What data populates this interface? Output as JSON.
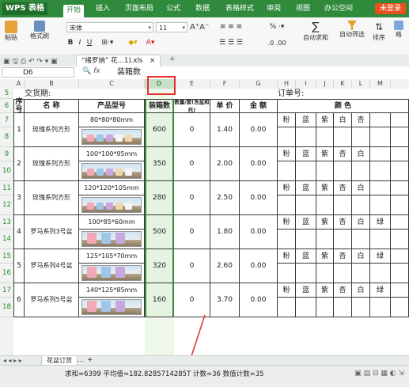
{
  "app": {
    "logo": "WPS 表格",
    "login": "未登录"
  },
  "menu": [
    "开始",
    "插入",
    "页面布局",
    "公式",
    "数据",
    "表格样式",
    "审阅",
    "视图",
    "办公空间"
  ],
  "ribbon": {
    "paste": "粘贴",
    "format_painter": "格式刷",
    "font_name": "宋体",
    "font_size": "11",
    "autosum": "自动求和",
    "autofilter": "自动筛选",
    "sort": "排序",
    "format_label": "格"
  },
  "document": {
    "tab": "“绪罗纳” 花…1).xls",
    "close": "×",
    "add": "+"
  },
  "formula_bar": {
    "cell_ref": "D6",
    "fx": "fx",
    "content": "装箱数"
  },
  "columns": [
    "A",
    "B",
    "C",
    "D",
    "E",
    "F",
    "G",
    "H",
    "I",
    "J",
    "K",
    "L",
    "M"
  ],
  "rows": [
    "5",
    "6",
    "7",
    "8",
    "9",
    "10",
    "11",
    "12",
    "13",
    "14",
    "15",
    "16",
    "17",
    "18"
  ],
  "sheet": {
    "delivery_label": "交货期:",
    "order_label": "订单号:",
    "headers": {
      "seq": "序号",
      "name": "名  称",
      "model": "产品型号",
      "box": "装箱数",
      "qty": "数量/套(含盆和托)",
      "price": "单 价",
      "amount": "金 额",
      "color": "颜    色"
    },
    "items": [
      {
        "seq": "1",
        "name": "玫瑰系列方形",
        "model": "80*80*80mm",
        "box": "600",
        "qty": "0",
        "price": "1.40",
        "amount": "0.00",
        "colors": [
          "粉",
          "蓝",
          "紫",
          "白",
          "杏"
        ]
      },
      {
        "seq": "2",
        "name": "玫瑰系列方形",
        "model": "100*100*95mm",
        "box": "350",
        "qty": "0",
        "price": "2.00",
        "amount": "0.00",
        "colors": [
          "粉",
          "蓝",
          "紫",
          "杏",
          "白"
        ]
      },
      {
        "seq": "3",
        "name": "玫瑰系列方形",
        "model": "120*120*105mm",
        "box": "280",
        "qty": "0",
        "price": "2.50",
        "amount": "0.00",
        "colors": [
          "粉",
          "蓝",
          "紫",
          "杏",
          "白"
        ]
      },
      {
        "seq": "4",
        "name": "罗马系列3号盆",
        "model": "100*85*60mm",
        "box": "500",
        "qty": "0",
        "price": "1.80",
        "amount": "0.00",
        "colors": [
          "粉",
          "蓝",
          "紫",
          "杏",
          "白",
          "绿"
        ]
      },
      {
        "seq": "5",
        "name": "罗马系列4号盆",
        "model": "125*105*70mm",
        "box": "320",
        "qty": "0",
        "price": "2.60",
        "amount": "0.00",
        "colors": [
          "粉",
          "蓝",
          "紫",
          "杏",
          "白",
          "绿"
        ]
      },
      {
        "seq": "6",
        "name": "罗马系列5号盆",
        "model": "140*125*85mm",
        "box": "160",
        "qty": "0",
        "price": "3.70",
        "amount": "0.00",
        "colors": [
          "粉",
          "蓝",
          "紫",
          "杏",
          "白",
          "绿"
        ]
      }
    ]
  },
  "sheet_tabs": {
    "active": "花盆订货",
    "more": "…",
    "add": "+"
  },
  "status": {
    "summary": "求和=6399  平均值=182.8285714285T  计数=36  数值计数=35"
  },
  "colors": {
    "accent": "#2f8a3c",
    "annotation": "#e53030",
    "selected_col": "#c6dfc6"
  }
}
